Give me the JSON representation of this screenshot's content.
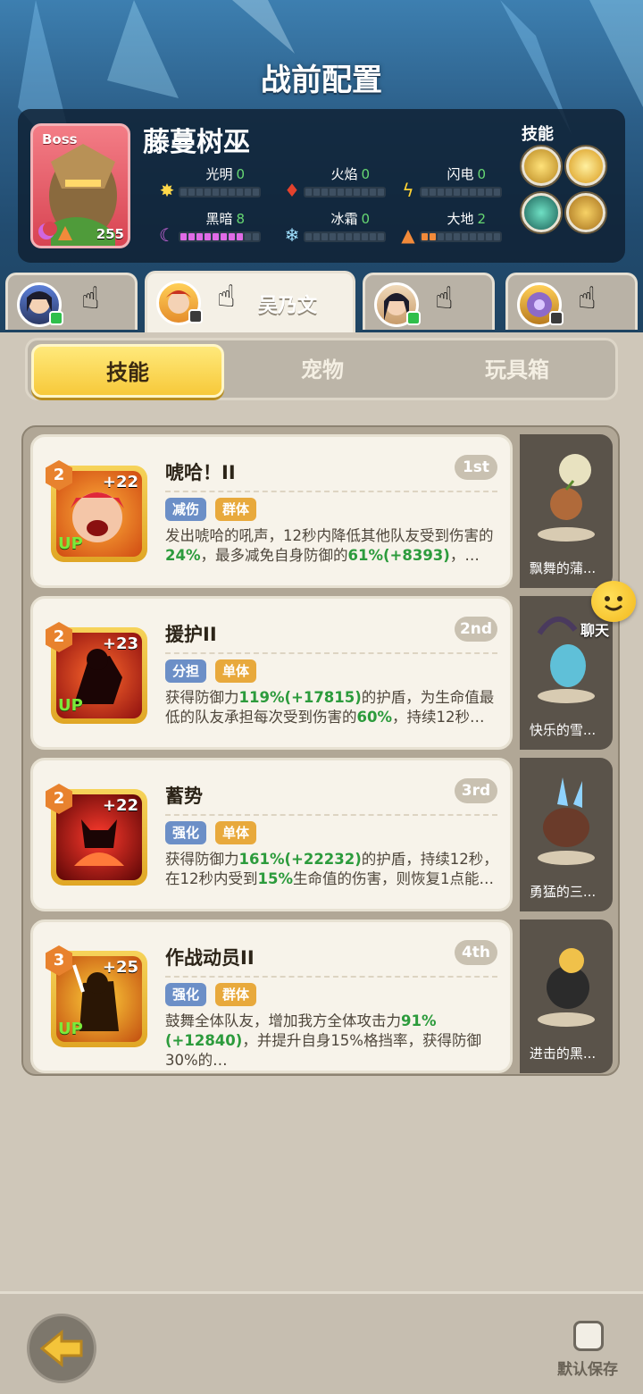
{
  "page_title": "战前配置",
  "boss": {
    "tag": "Boss",
    "name": "藤蔓树巫",
    "level": "255",
    "attributes": [
      {
        "label": "光明",
        "value": "0",
        "filled": 0
      },
      {
        "label": "火焰",
        "value": "0",
        "filled": 0
      },
      {
        "label": "闪电",
        "value": "0",
        "filled": 0
      },
      {
        "label": "黑暗",
        "value": "8",
        "filled": 8
      },
      {
        "label": "冰霜",
        "value": "0",
        "filled": 0
      },
      {
        "label": "大地",
        "value": "2",
        "filled": 2
      }
    ],
    "skills_title": "技能"
  },
  "players": [
    {
      "name": ""
    },
    {
      "name": "吴乃文"
    },
    {
      "name": ""
    },
    {
      "name": ""
    }
  ],
  "categories": [
    "技能",
    "宠物",
    "玩具箱"
  ],
  "skills": [
    {
      "name": "唬哈！II",
      "order": "1st",
      "level": "2",
      "plus": "+22",
      "up": "UP",
      "tags": [
        "减伤",
        "群体"
      ],
      "desc_parts": [
        "发出唬哈的吼声，12秒内降低其他队友受到伤害的",
        "24%",
        "，最多减免自身防御的",
        "61%(+8393)",
        "，…"
      ],
      "pet": "飘舞的蒲..."
    },
    {
      "name": "援护II",
      "order": "2nd",
      "level": "2",
      "plus": "+23",
      "up": "UP",
      "tags": [
        "分担",
        "单体"
      ],
      "desc_parts": [
        "获得防御力",
        "119%(+17815)",
        "的护盾，为生命值最低的队友承担每次受到伤害的",
        "60%",
        "，持续12秒…"
      ],
      "pet": "快乐的雪..."
    },
    {
      "name": "蓄势",
      "order": "3rd",
      "level": "2",
      "plus": "+22",
      "up": "",
      "tags": [
        "强化",
        "单体"
      ],
      "desc_parts": [
        "获得防御力",
        "161%(+22232)",
        "的护盾，持续12秒，在12秒内受到",
        "15%",
        "生命值的伤害，则恢复1点能…"
      ],
      "pet": "勇猛的三..."
    },
    {
      "name": "作战动员II",
      "order": "4th",
      "level": "3",
      "plus": "+25",
      "up": "UP",
      "tags": [
        "强化",
        "群体"
      ],
      "desc_parts": [
        "鼓舞全体队友，增加我方全体攻击力",
        "91%(+12840)",
        "，并提升自身15%格挡率，获得防御30%的…",
        "",
        ""
      ],
      "pet": "进击的黑..."
    }
  ],
  "chat_label": "聊天",
  "default_save_label": "默认保存"
}
